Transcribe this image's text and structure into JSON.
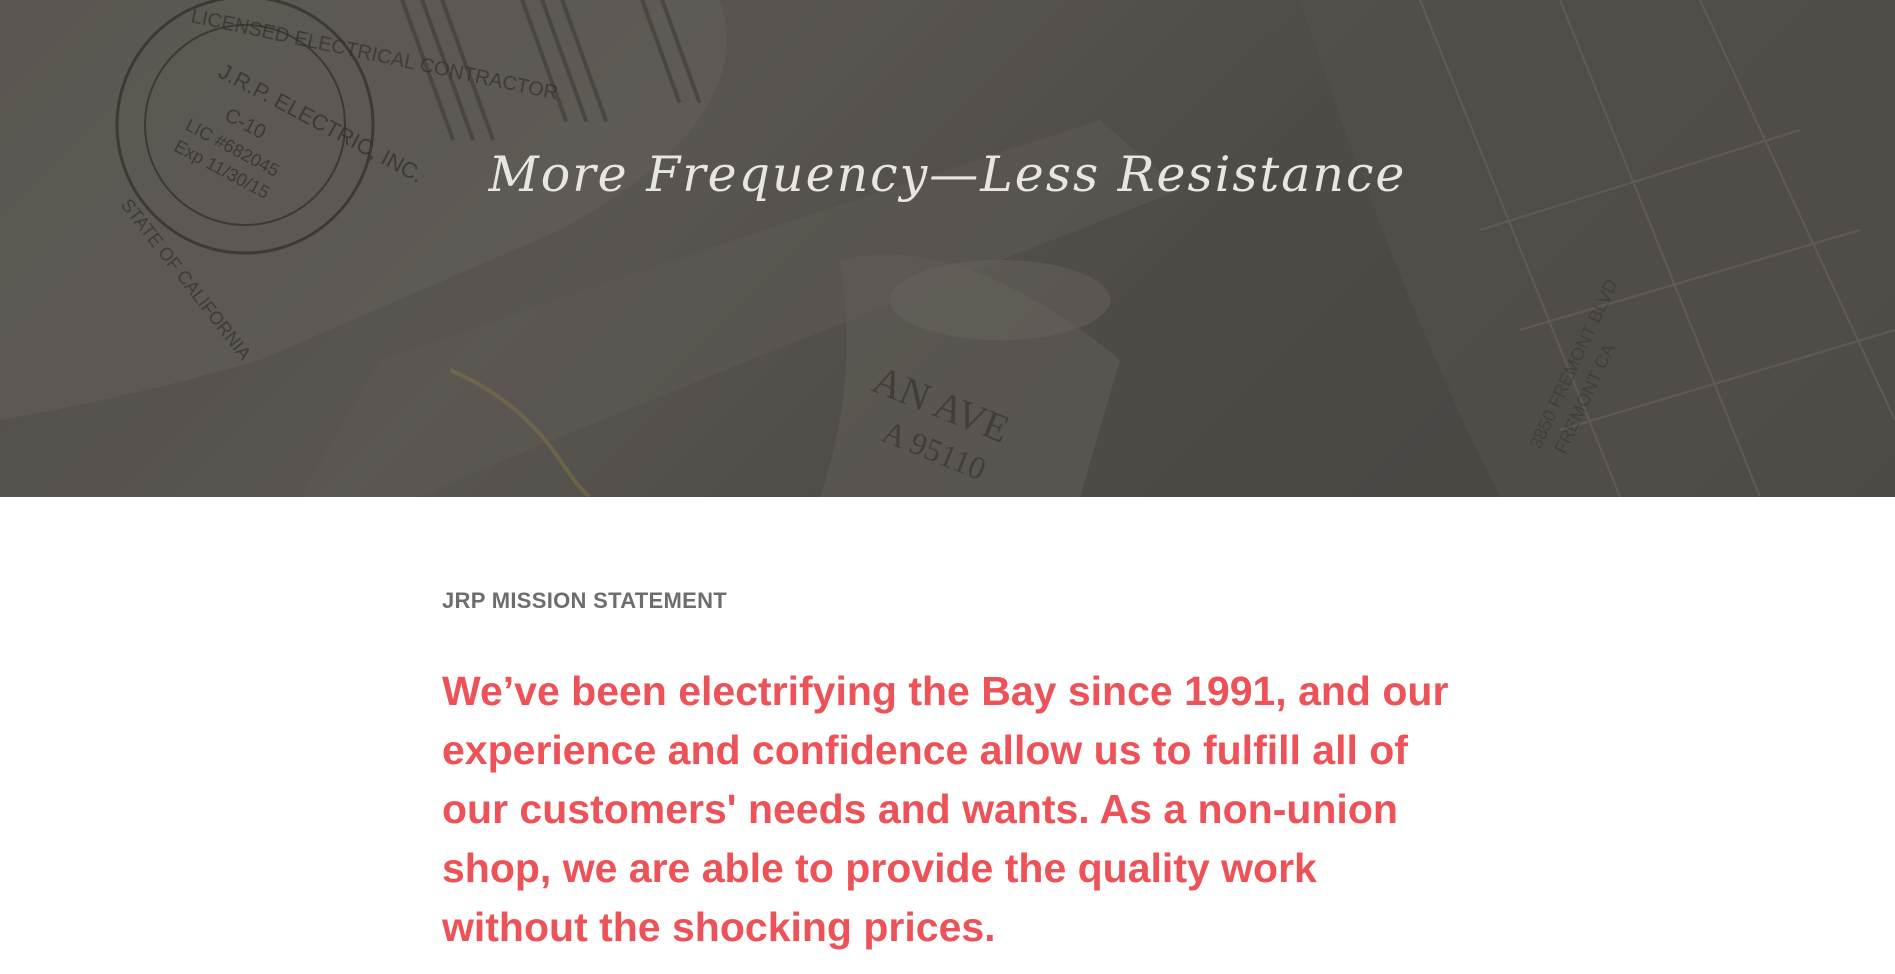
{
  "hero": {
    "title": "More Frequency—Less Resistance",
    "stamp": {
      "ring_top": "LICENSED ELECTRICAL CONTRACTOR",
      "ring_bottom": "STATE OF CALIFORNIA",
      "center_name": "J.R.P. ELECTRIC, INC.",
      "class": "C-10",
      "license": "LIC #682045",
      "expires": "Exp 11/30/15"
    },
    "background_text": {
      "address_fragment": "AN AVE",
      "zip_fragment": "A 95110",
      "street_fragment": "3850 FREMONT BLVD",
      "city_fragment": "FREMONT CA"
    }
  },
  "mission": {
    "eyebrow": "JRP MISSION STATEMENT",
    "statement": "We’ve been electrifying the Bay since 1991, and our experience and confidence allow us to fulfill all of our customers' needs and wants. As a non-union shop, we are able to provide the quality work without the shocking prices."
  },
  "colors": {
    "accent": "#ec5257",
    "eyebrow": "#6d6d6d",
    "hero_text": "#e9e6e2"
  }
}
